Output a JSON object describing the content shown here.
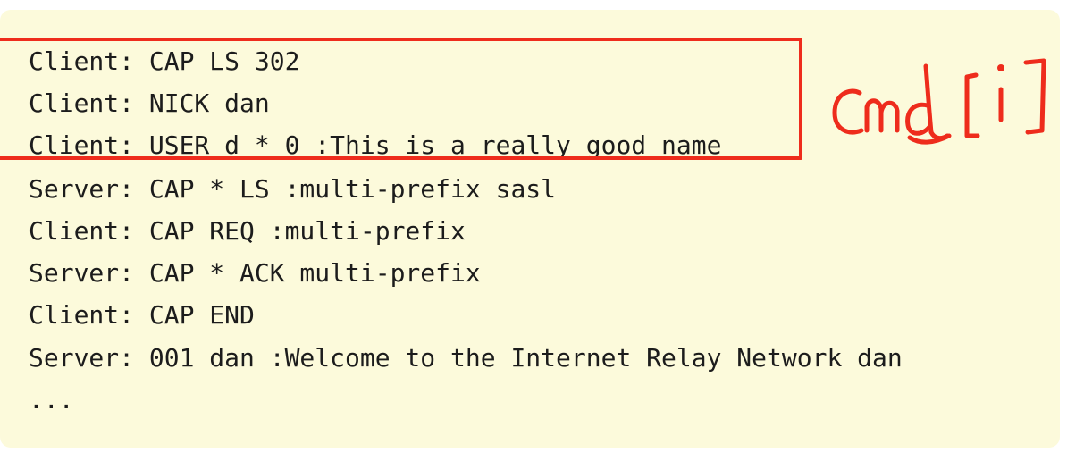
{
  "colors": {
    "panel_background": "#fcfadb",
    "text": "#1c1c1c",
    "annotation_red": "#ee2c1c"
  },
  "code": {
    "lines": [
      "Client: CAP LS 302",
      "Client: NICK dan",
      "Client: USER d * 0 :This is a really good name",
      "Server: CAP * LS :multi-prefix sasl",
      "Client: CAP REQ :multi-prefix",
      "Server: CAP * ACK multi-prefix",
      "Client: CAP END",
      "Server: 001 dan :Welcome to the Internet Relay Network dan",
      "..."
    ]
  },
  "annotation": {
    "handwritten_text": "cmd[i]"
  }
}
